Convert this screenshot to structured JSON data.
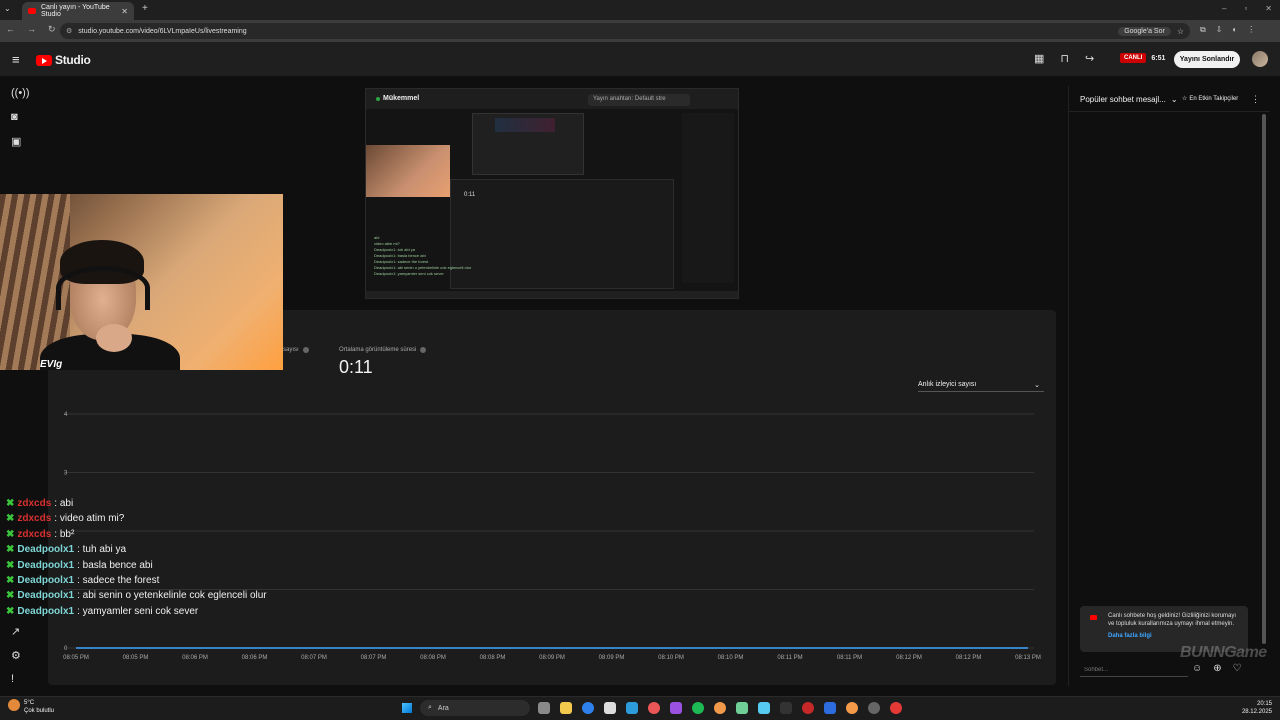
{
  "browser": {
    "tab_title": "Canlı yayın - YouTube Studio",
    "url": "studio.youtube.com/video/6LVLmpaIeUs/livestreaming",
    "google_ask": "Google'a Sor"
  },
  "header": {
    "logo_text": "Studio",
    "live_label": "CANLI",
    "live_time": "6:51",
    "end_stream": "Yayını Sonlandır"
  },
  "preview": {
    "title": "Mükemmel",
    "stream_key": "Yayın anahtarı: Default stre",
    "time": "0:11",
    "chat_lines": [
      "abi",
      "video atim mi?",
      "Deadpoolx1: tuh abi ya",
      "Deadpoolx1: basla bence abi",
      "Deadpoolx1: sadece the forest",
      "Deadpoolx1: abi senin o yetenkelinle cok eglenceli olur",
      "Deadpoolx1: yamyamler seni cok sever"
    ]
  },
  "analytics": {
    "metric_label_partial": "sayısı",
    "metric_label": "Ortalama görüntüleme süresi",
    "metric_value": "0:11",
    "dropdown_label": "Anlık izleyici sayısı"
  },
  "chart_data": {
    "type": "line",
    "title": "",
    "xlabel": "",
    "ylabel": "",
    "x": [
      "08:05 PM",
      "08:05 PM",
      "08:06 PM",
      "08:06 PM",
      "08:07 PM",
      "08:07 PM",
      "08:08 PM",
      "08:08 PM",
      "08:09 PM",
      "08:09 PM",
      "08:10 PM",
      "08:10 PM",
      "08:11 PM",
      "08:11 PM",
      "08:12 PM",
      "08:12 PM",
      "08:13 PM"
    ],
    "yticks": [
      "0",
      "",
      "",
      "3",
      "4"
    ],
    "ylim": [
      0,
      4
    ],
    "series": [
      {
        "values": [
          0,
          0,
          0,
          0,
          0,
          0,
          0,
          0,
          0,
          0,
          0,
          0,
          0,
          0,
          0,
          0,
          0
        ]
      }
    ],
    "colors": {
      "line": "#3ea6ff",
      "grid": "#333333"
    }
  },
  "webcam": {
    "overlay_text": "EVIg"
  },
  "chat_overlay": [
    {
      "user": "zdxcds",
      "msg": "abi",
      "color": "#d93030"
    },
    {
      "user": "zdxcds",
      "msg": "video atim mi?",
      "color": "#d93030"
    },
    {
      "user": "zdxcds",
      "msg": "bb²",
      "color": "#d93030"
    },
    {
      "user": "Deadpoolx1",
      "msg": "tuh abi ya",
      "color": "#7fd6d6"
    },
    {
      "user": "Deadpoolx1",
      "msg": "basla bence abi",
      "color": "#7fd6d6"
    },
    {
      "user": "Deadpoolx1",
      "msg": "sadece the forest",
      "color": "#7fd6d6"
    },
    {
      "user": "Deadpoolx1",
      "msg": "abi senin o yetenkelinle cok eglenceli olur",
      "color": "#7fd6d6"
    },
    {
      "user": "Deadpoolx1",
      "msg": "yamyamler seni cok sever",
      "color": "#7fd6d6"
    }
  ],
  "live_chat": {
    "mode": "Popüler sohbet mesajl...",
    "top_fans": "En Etkin Takipçiler",
    "welcome_text": "Canlı sohbete hoş geldiniz! Gizliliğinizi korumayı ve topluluk kurallarımıza uymayı ihmal etmeyin.",
    "learn_more": "Daha fazla bilgi",
    "input_placeholder": "Sohbet...",
    "watermark": "BUNNGame"
  },
  "taskbar": {
    "weather_temp": "5°C",
    "weather_desc": "Çok bulutlu",
    "search": "Ara",
    "time": "20:15",
    "date": "28.12.2025"
  }
}
